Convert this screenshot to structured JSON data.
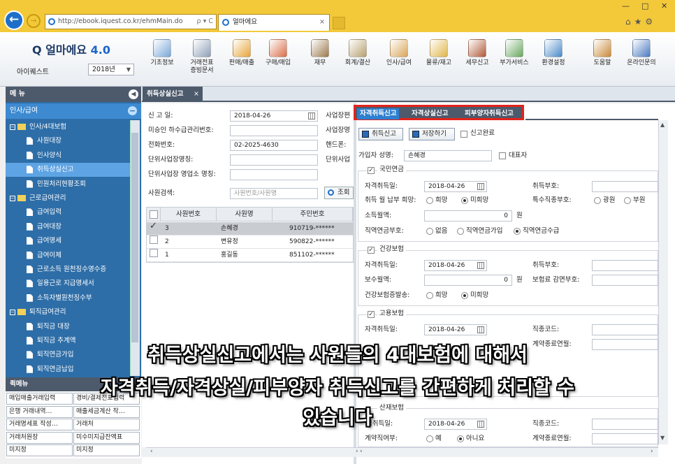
{
  "browser": {
    "url": "http://ebook.iquest.co.kr/ehmMain.do",
    "url_controls": "ρ ▾ C",
    "tab_title": "얼마에요",
    "tab_close": "×",
    "window_controls": {
      "minimize": "—",
      "maximize": "□",
      "close": "✕"
    },
    "right_icons": "⌂★⚙"
  },
  "app": {
    "logo_main": "얼마에요",
    "logo_version": "4.0",
    "company": "아이퀘스트",
    "year": "2018년",
    "toolbar": [
      {
        "label": "기초정보",
        "icon": "basic-info-icon",
        "color": "#7aa7d8"
      },
      {
        "label": "거래전표\n증빙문서",
        "icon": "voucher-icon",
        "color": "#8fa0b8"
      },
      {
        "label": "판매/매출",
        "icon": "sales-icon",
        "color": "#e8a53a"
      },
      {
        "label": "구매/매입",
        "icon": "purchase-icon",
        "color": "#d96f4a"
      },
      {
        "label": "재무",
        "icon": "finance-icon",
        "color": "#9c7a4e"
      },
      {
        "label": "회계/결산",
        "icon": "accounting-icon",
        "color": "#b8a070"
      },
      {
        "label": "인사/급여",
        "icon": "hr-payroll-icon",
        "color": "#d9a65a"
      },
      {
        "label": "물류/재고",
        "icon": "logistics-icon",
        "color": "#e0b64a"
      },
      {
        "label": "세무신고",
        "icon": "tax-report-icon",
        "color": "#b05a3a"
      },
      {
        "label": "부가서비스",
        "icon": "extra-service-icon",
        "color": "#6aa860"
      },
      {
        "label": "환경설정",
        "icon": "settings-icon",
        "color": "#4a8ac8"
      },
      {
        "label": "도움말",
        "icon": "help-icon",
        "color": "#c98a3a"
      },
      {
        "label": "온라인문의",
        "icon": "online-inquiry-icon",
        "color": "#4a7ac0"
      }
    ]
  },
  "sidebar": {
    "header": "메 뉴",
    "category": "인사/급여",
    "items": [
      {
        "label": "인사/4대보험",
        "type": "folder"
      },
      {
        "label": "사원대장",
        "type": "file"
      },
      {
        "label": "인사양식",
        "type": "file"
      },
      {
        "label": "취득상실신고",
        "type": "file",
        "selected": true
      },
      {
        "label": "민원처리현황조회",
        "type": "file"
      },
      {
        "label": "근로급여관리",
        "type": "folder"
      },
      {
        "label": "급여입력",
        "type": "file"
      },
      {
        "label": "급여대장",
        "type": "file"
      },
      {
        "label": "급여명세",
        "type": "file"
      },
      {
        "label": "급여이체",
        "type": "file"
      },
      {
        "label": "근로소득 원천징수영수증",
        "type": "file"
      },
      {
        "label": "일용근로 지급명세서",
        "type": "file"
      },
      {
        "label": "소득자별원천징수부",
        "type": "file"
      },
      {
        "label": "퇴직급여관리",
        "type": "folder"
      },
      {
        "label": "퇴직금 대장",
        "type": "file"
      },
      {
        "label": "퇴직금 추계액",
        "type": "file"
      },
      {
        "label": "퇴직연금가입",
        "type": "file"
      },
      {
        "label": "퇴직연금납입",
        "type": "file"
      }
    ],
    "quick_header": "퀵메뉴",
    "quick_items": [
      "매입매출거래입력",
      "경비/결제전표입력",
      "은행 거래내역…",
      "매출세금계산 작…",
      "거래명세표 작성…",
      "거래처",
      "거래처원장",
      "미수미지급잔액표",
      "미지정",
      "미지정"
    ]
  },
  "doc_tab": {
    "label": "취득상실신고",
    "close": "×"
  },
  "form": {
    "report_date_label": "신 고 일:",
    "report_date": "2018-04-26",
    "subcontract_label": "미승인 하수급관리번호:",
    "phone_label": "전화번호:",
    "phone": "02-2025-4630",
    "unit_name_label": "단위사업장명칭:",
    "unit_branch_label": "단위사업장 영업소 명칭:",
    "biz_site_label": "사업장편",
    "biz_name_label": "사업장명",
    "mobile_label": "핸드폰:",
    "unit_biz_label": "단위사업",
    "search_label": "사원검색:",
    "search_placeholder": "사원번호/사원명",
    "search_button": "조회"
  },
  "grid": {
    "headers": [
      "사원번호",
      "사원명",
      "주민번호"
    ],
    "rows": [
      {
        "no": "3",
        "name": "손혜경",
        "ssn": "910719-******",
        "checked": true
      },
      {
        "no": "2",
        "name": "변유정",
        "ssn": "590822-******",
        "checked": false
      },
      {
        "no": "1",
        "name": "홍길동",
        "ssn": "851102-******",
        "checked": false
      }
    ],
    "check_mark": "✓"
  },
  "report_tabs": [
    "자격취득신고",
    "자격상실신고",
    "피부양자취득신고"
  ],
  "actions": {
    "report_button": "취득신고",
    "save_button": "저장하기",
    "complete_label": "신고완료"
  },
  "member": {
    "name_label": "가입자 성명:",
    "name": "손혜경",
    "rep_label": "대표자"
  },
  "pension": {
    "title": "국민연금",
    "acq_date_label": "자격취득일:",
    "acq_date": "2018-04-26",
    "acq_code_label": "취득부호:",
    "pay_wish_label": "취득 월 납부 희망:",
    "pay_opts": [
      "희망",
      "미희망"
    ],
    "special_label": "특수직종부호:",
    "special_opts": [
      "광원",
      "부원"
    ],
    "income_label": "소득월액:",
    "income_value": "0",
    "won": "원",
    "occ_label": "직역연금부호:",
    "occ_opts": [
      "없음",
      "직역연금가입",
      "직역연금수급"
    ]
  },
  "health": {
    "title": "건강보험",
    "acq_date_label": "자격취득일:",
    "acq_date": "2018-04-26",
    "acq_code_label": "취득부호:",
    "pay_label": "보수월액:",
    "pay_value": "0",
    "won": "원",
    "reduce_label": "보험료 감면부호:",
    "card_label": "건강보험증발송:",
    "card_opts": [
      "희망",
      "미희망"
    ]
  },
  "employment": {
    "title": "고용보험",
    "acq_date_label": "자격취득일:",
    "acq_date": "2018-04-26",
    "job_code_label": "직종코드:",
    "contract_end_label": "계약종료연월:"
  },
  "industrial": {
    "title": "산재보험",
    "acq_date_label": "격취득일:",
    "acq_date": "2018-04-26",
    "job_code_label": "직종코드:",
    "contract_label": "계약직여부:",
    "contract_opts": [
      "예",
      "아니요"
    ],
    "contract_end_label": "계약종료연월:"
  },
  "subtitle": {
    "line1": "취득상실신고에서는 사원들의 4대보험에 대해서",
    "line2": "자격취득/자격상실/피부양자 취득신고를 간편하게 처리할 수",
    "line3": "있습니다"
  },
  "colors": {
    "browser_bar": "#f3c93a",
    "sidebar": "#2e6ea8",
    "header_dark": "#4d5a6c",
    "highlight_border": "#e3231b",
    "active_tab": "#2d7fcf"
  }
}
